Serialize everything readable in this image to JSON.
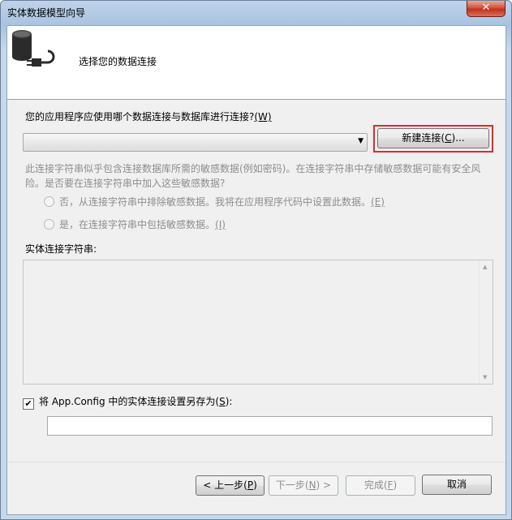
{
  "window": {
    "title": "实体数据模型向导",
    "close_glyph": "✕"
  },
  "header": {
    "title": "选择您的数据连接",
    "icon": "database-plug-icon"
  },
  "question": {
    "text": "您的应用程序应使用哪个数据连接与数据库进行连接?",
    "accel": "(W)"
  },
  "connection_combo": {
    "value": ""
  },
  "new_connection_button": {
    "label": "新建连接(",
    "accel": "C",
    "suffix": ")..."
  },
  "sensitive_hint": "此连接字符串似乎包含连接数据库所需的敏感数据(例如密码)。在连接字符串中存储敏感数据可能有安全风险。是否要在连接字符串中加入这些敏感数据?",
  "radio_exclude": {
    "label": "否，从连接字符串中排除敏感数据。我将在应用程序代码中设置此数据。",
    "accel": "(E)"
  },
  "radio_include": {
    "label": "是，在连接字符串中包括敏感数据。",
    "accel": "(I)"
  },
  "entity_connection": {
    "label": "实体连接字符串:",
    "value": ""
  },
  "save_setting": {
    "label": "将 App.Config 中的实体连接设置另存为(",
    "accel": "S",
    "suffix": "):",
    "checked": true,
    "value": ""
  },
  "buttons": {
    "back": {
      "label": "< 上一步(",
      "accel": "P",
      "suffix": ")"
    },
    "next": {
      "label": "下一步(",
      "accel": "N",
      "suffix": ") >"
    },
    "finish": {
      "label": "完成(",
      "accel": "F",
      "suffix": ")"
    },
    "cancel": "取消"
  },
  "colors": {
    "highlight": "#e02a2a",
    "disabled_text": "#8d8d8d"
  }
}
